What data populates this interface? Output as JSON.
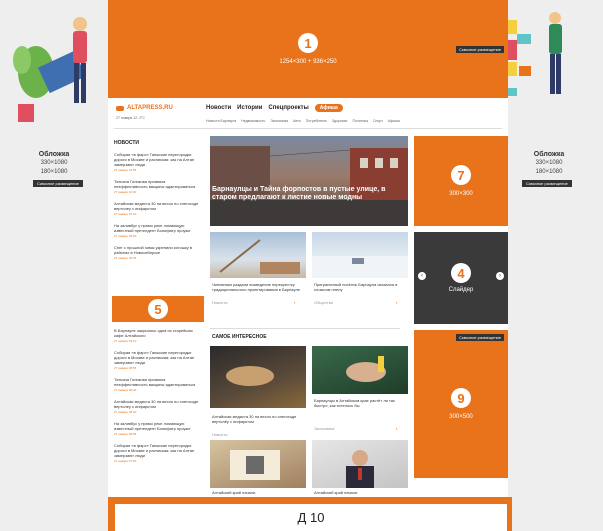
{
  "top_banner": {
    "number": "1",
    "dims": "1254×300 + 936×250",
    "badge": "Сквозное размещение"
  },
  "header": {
    "logo": "ALTAPRESS.RU",
    "date": "27 января  12: 2°C",
    "nav": [
      "Новости",
      "Истории",
      "Спецпроекты"
    ],
    "nav_pill": "Афиша",
    "subnav": [
      "Новости Барнаула",
      "Недвижимость",
      "Экономика",
      "Авто",
      "Потребитель",
      "Здоровье",
      "Политика",
      "Спорт",
      "Афиша"
    ]
  },
  "left_column": {
    "heading": "НОВОСТИ",
    "items_top": [
      {
        "text": "Собирая «в фарс» Ганжские перегородки дороги в Москве и распиская: как на Алтае замерзают люди",
        "meta": "27 января 10:55"
      },
      {
        "text": "Татьяна Голикова призвала неэффективность вакцины адаптироваться",
        "meta": "27 января 10:30"
      },
      {
        "text": "Алтайская медиста 30 на весоо по снегоходе вертолеу с инфарктом",
        "meta": "27 января 10:10"
      },
      {
        "text": "На заливбус у прямо реке ломающую известный претендент Бонифатр проуже",
        "meta": "27 января 09:50"
      },
      {
        "text": "Снег с прошлой зимы укрепили котошку в районах в Новосибирске",
        "meta": "27 января 09:35"
      }
    ],
    "slot_number": "5",
    "items_bottom": [
      {
        "text": "В Барнауле закрылись одна из старейших кафе Алтайского",
        "meta": "27 января 09:10"
      },
      {
        "text": "Собирая «в фарс» Ганжские перегородки дороги в Москве и распиская: как на Алтае замерзают люди",
        "meta": "27 января 08:55"
      },
      {
        "text": "Татьяна Голикова призвала неэффективность вакцины адаптироваться",
        "meta": "27 января 08:40"
      },
      {
        "text": "Алтайская медиста 30 на весоо по снегоходе вертолеу с инфарктом",
        "meta": "27 января 08:20"
      },
      {
        "text": "На заливбус у прямо реке ломающую известный претендент Бонифатр проуже",
        "meta": "27 января 08:05"
      },
      {
        "text": "Собирая «в фарс» Ганжские перегородки дороги в Москве и распиская: как на Алтае замерзают люди",
        "meta": "27 января 07:50"
      }
    ]
  },
  "hero": {
    "title": "Барнаулцы и Тайна форпостов в пустые улице, в старом предлагают к листие новые модны"
  },
  "cards_row1": [
    {
      "caption": "Чиновники раздали возведение перекрестку традиционального проектирования в Барнауле",
      "meta": "Новости"
    },
    {
      "caption": "Приграничный посёлок Барнаула оказался в сложном плену",
      "meta": "Общество"
    }
  ],
  "section_heading": "САМОЕ ИНТЕРЕСНОЕ",
  "cards_row2": [
    {
      "caption": "Алтайская медиста 30 на весоо по снегоходе вертолёу с инфарктом",
      "meta": "Новости"
    },
    {
      "caption": "Барнаулцы в Алтайском крае растёт ли так быстро, как хотелось бы",
      "meta": "Экономика"
    }
  ],
  "cards_row3": [
    {
      "caption": "Алтайский край начали",
      "meta": ""
    },
    {
      "caption": "Алтайский край начали",
      "meta": ""
    }
  ],
  "right_slots": {
    "slot7": {
      "number": "7",
      "dims": "300×300"
    },
    "slider": {
      "number": "4",
      "label": "Слайдер"
    },
    "slot9": {
      "number": "9",
      "dims": "300×500",
      "badge": "Сквозное размещение"
    }
  },
  "side_ads": {
    "left": {
      "title": "Обложка",
      "line1": "330×1080",
      "line2": "180×1080",
      "chip": "Сквозное размещение"
    },
    "right": {
      "title": "Обложка",
      "line1": "330×1080",
      "line2": "180×1080",
      "chip": "Сквозное размещение"
    }
  },
  "bottom_banner": {
    "label": "Д 10"
  }
}
